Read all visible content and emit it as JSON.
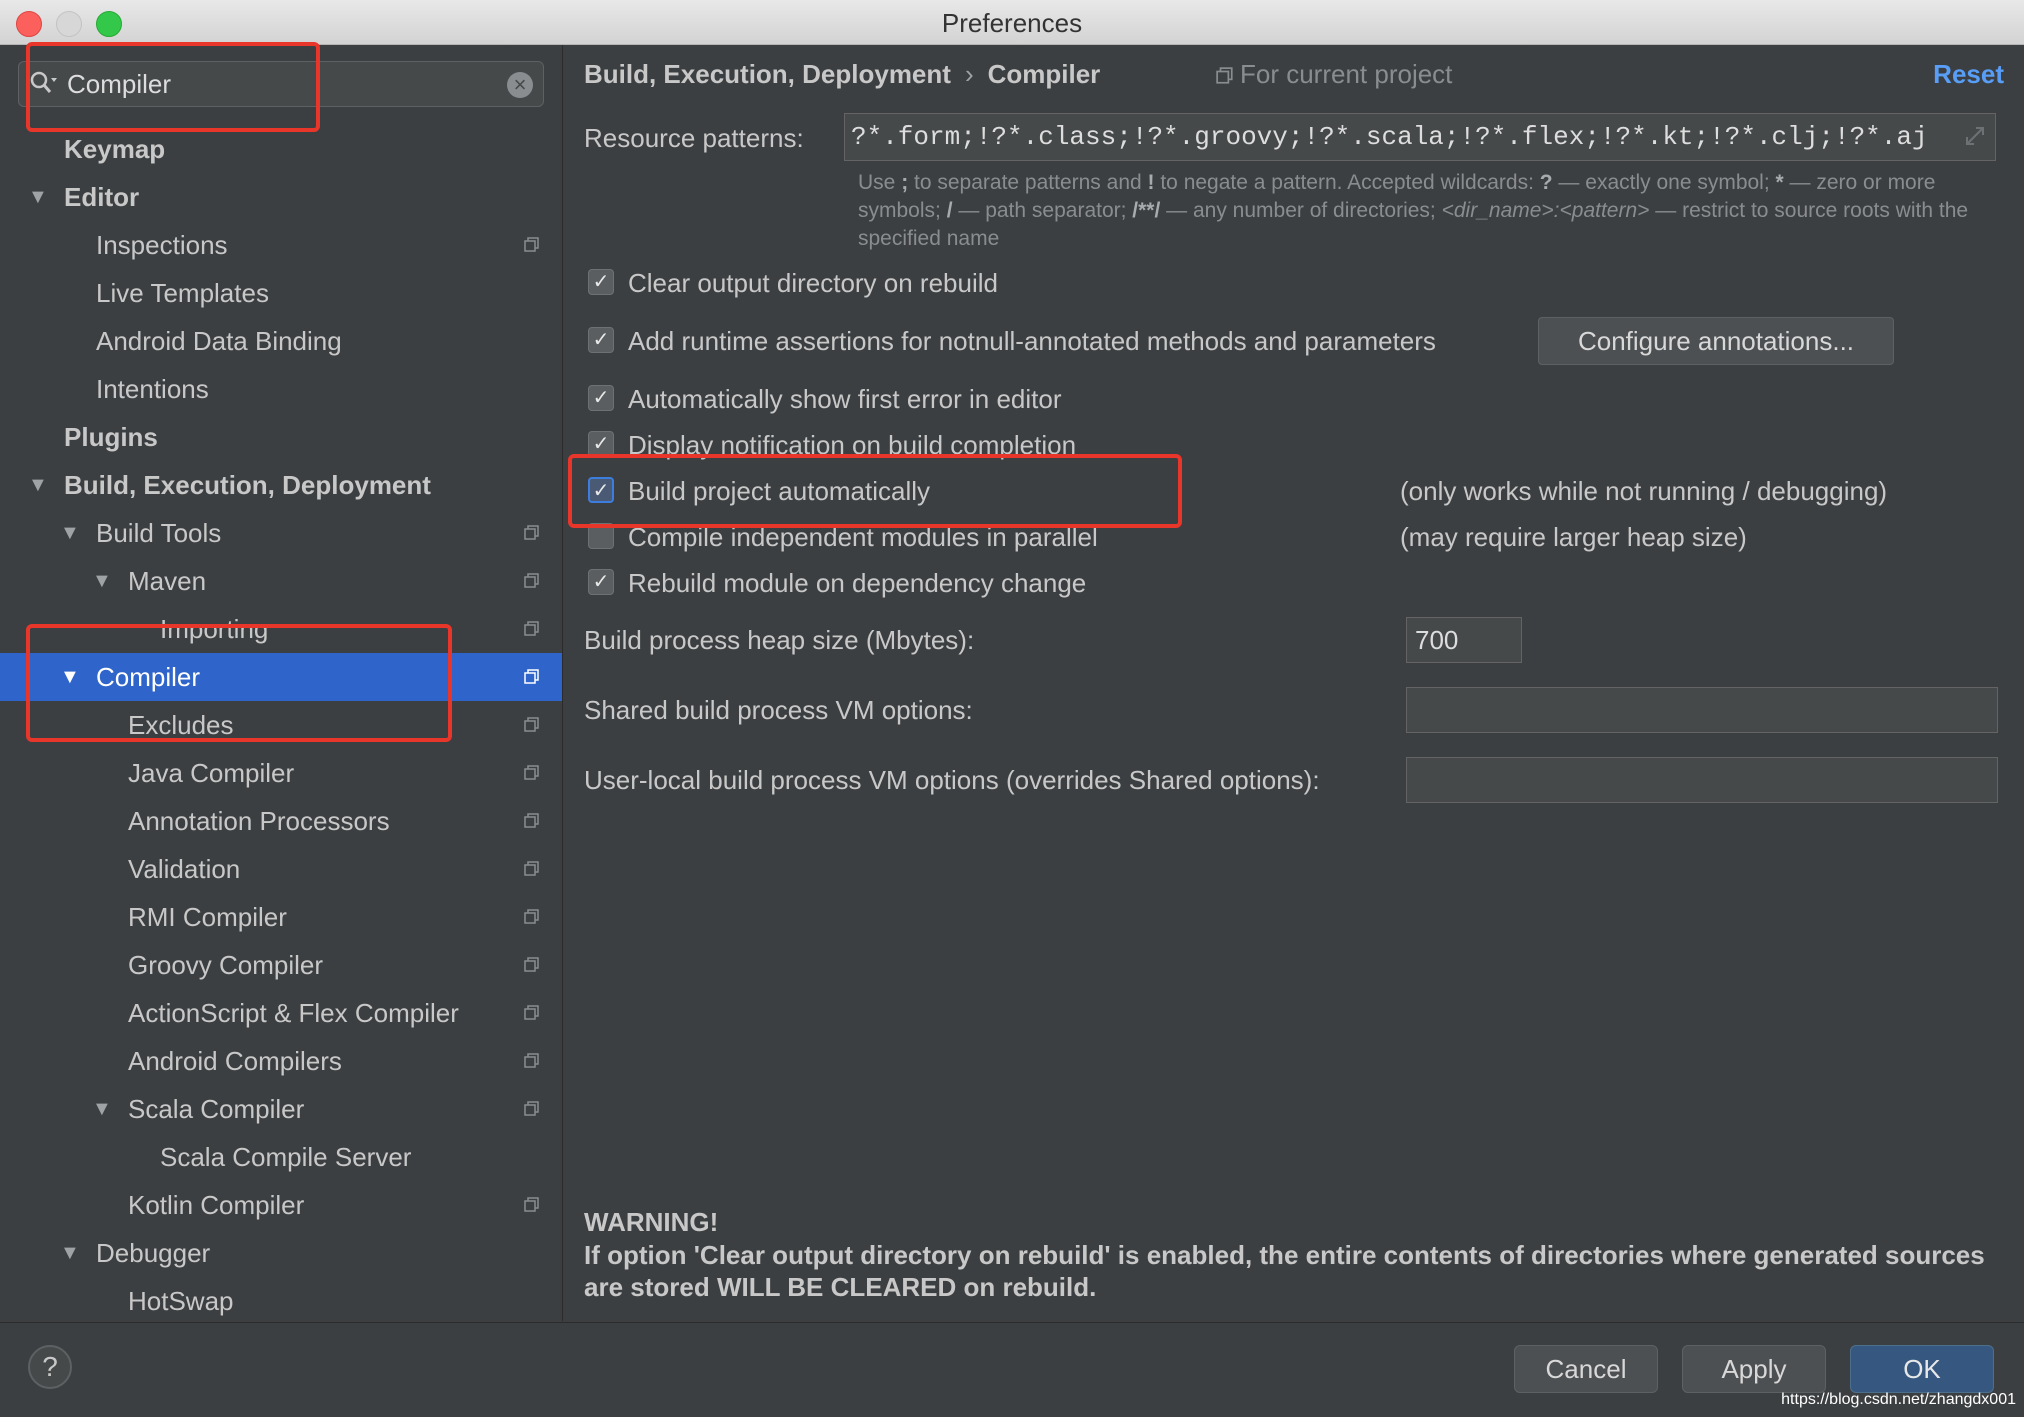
{
  "window": {
    "title": "Preferences"
  },
  "search": {
    "value": "Compiler"
  },
  "sidebar": {
    "items": [
      {
        "label": "Keymap",
        "indent": 0,
        "arrow": "",
        "bold": true,
        "copy": false
      },
      {
        "label": "Editor",
        "indent": 0,
        "arrow": "▼",
        "bold": true,
        "copy": false
      },
      {
        "label": "Inspections",
        "indent": 1,
        "arrow": "",
        "bold": false,
        "copy": true
      },
      {
        "label": "Live Templates",
        "indent": 1,
        "arrow": "",
        "bold": false,
        "copy": false
      },
      {
        "label": "Android Data Binding",
        "indent": 1,
        "arrow": "",
        "bold": false,
        "copy": false
      },
      {
        "label": "Intentions",
        "indent": 1,
        "arrow": "",
        "bold": false,
        "copy": false
      },
      {
        "label": "Plugins",
        "indent": 0,
        "arrow": "",
        "bold": true,
        "copy": false
      },
      {
        "label": "Build, Execution, Deployment",
        "indent": 0,
        "arrow": "▼",
        "bold": true,
        "copy": false
      },
      {
        "label": "Build Tools",
        "indent": 1,
        "arrow": "▼",
        "bold": false,
        "copy": true
      },
      {
        "label": "Maven",
        "indent": 2,
        "arrow": "▼",
        "bold": false,
        "copy": true
      },
      {
        "label": "Importing",
        "indent": 3,
        "arrow": "",
        "bold": false,
        "copy": true
      },
      {
        "label": "Compiler",
        "indent": 1,
        "arrow": "▼",
        "bold": false,
        "copy": true,
        "selected": true
      },
      {
        "label": "Excludes",
        "indent": 2,
        "arrow": "",
        "bold": false,
        "copy": true
      },
      {
        "label": "Java Compiler",
        "indent": 2,
        "arrow": "",
        "bold": false,
        "copy": true
      },
      {
        "label": "Annotation Processors",
        "indent": 2,
        "arrow": "",
        "bold": false,
        "copy": true
      },
      {
        "label": "Validation",
        "indent": 2,
        "arrow": "",
        "bold": false,
        "copy": true
      },
      {
        "label": "RMI Compiler",
        "indent": 2,
        "arrow": "",
        "bold": false,
        "copy": true
      },
      {
        "label": "Groovy Compiler",
        "indent": 2,
        "arrow": "",
        "bold": false,
        "copy": true
      },
      {
        "label": "ActionScript & Flex Compiler",
        "indent": 2,
        "arrow": "",
        "bold": false,
        "copy": true
      },
      {
        "label": "Android Compilers",
        "indent": 2,
        "arrow": "",
        "bold": false,
        "copy": true
      },
      {
        "label": "Scala Compiler",
        "indent": 2,
        "arrow": "▼",
        "bold": false,
        "copy": true
      },
      {
        "label": "Scala Compile Server",
        "indent": 3,
        "arrow": "",
        "bold": false,
        "copy": false
      },
      {
        "label": "Kotlin Compiler",
        "indent": 2,
        "arrow": "",
        "bold": false,
        "copy": true
      },
      {
        "label": "Debugger",
        "indent": 1,
        "arrow": "▼",
        "bold": false,
        "copy": false
      },
      {
        "label": "HotSwap",
        "indent": 2,
        "arrow": "",
        "bold": false,
        "copy": false
      }
    ]
  },
  "header": {
    "breadcrumb_parent": "Build, Execution, Deployment",
    "breadcrumb_sep": "›",
    "breadcrumb_current": "Compiler",
    "scope": "For current project",
    "reset": "Reset"
  },
  "resource": {
    "label": "Resource patterns:",
    "value": "?*.form;!?*.class;!?*.groovy;!?*.scala;!?*.flex;!?*.kt;!?*.clj;!?*.aj",
    "hint_1": "Use ",
    "hint_semicolon": ";",
    "hint_2": " to separate patterns and ",
    "hint_bang": "!",
    "hint_3": " to negate a pattern. Accepted wildcards: ",
    "hint_q": "?",
    "hint_4": " — exactly one symbol; ",
    "hint_star": "*",
    "hint_5": " — zero or more symbols; ",
    "hint_slash": "/",
    "hint_6": " — path separator; ",
    "hint_dstar": "/**/",
    "hint_7": " — any number of directories; ",
    "hint_dirname": "<dir_name>:<pattern>",
    "hint_8": " — restrict to source roots with the specified name"
  },
  "options": {
    "clear_output": "Clear output directory on rebuild",
    "runtime_assertions": "Add runtime assertions for notnull-annotated methods and parameters",
    "configure_annotations": "Configure annotations...",
    "show_first_error": "Automatically show first error in editor",
    "display_notification": "Display notification on build completion",
    "build_automatically": "Build project automatically",
    "build_automatically_note": "(only works while not running / debugging)",
    "compile_parallel": "Compile independent modules in parallel",
    "compile_parallel_note": "(may require larger heap size)",
    "rebuild_on_dependency": "Rebuild module on dependency change"
  },
  "fields": {
    "heap_label": "Build process heap size (Mbytes):",
    "heap_value": "700",
    "shared_vm_label": "Shared build process VM options:",
    "shared_vm_value": "",
    "user_vm_label": "User-local build process VM options (overrides Shared options):",
    "user_vm_value": ""
  },
  "warning": {
    "title": "WARNING!",
    "text": "If option 'Clear output directory on rebuild' is enabled, the entire contents of directories where generated sources are stored WILL BE CLEARED on rebuild."
  },
  "footer": {
    "help": "?",
    "cancel": "Cancel",
    "apply": "Apply",
    "ok": "OK",
    "watermark": "https://blog.csdn.net/zhangdx001"
  },
  "colors": {
    "background": "#3c3f41",
    "selection": "#2f65ca",
    "link": "#589df6",
    "highlight": "#e8362b"
  }
}
